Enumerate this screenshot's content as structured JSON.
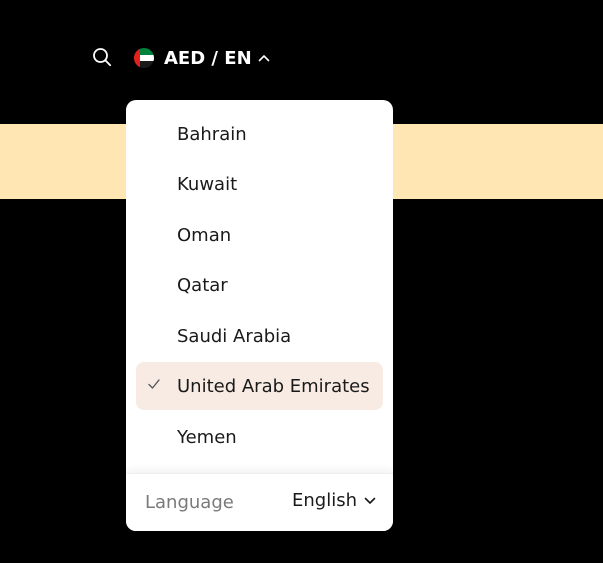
{
  "header": {
    "currency_language": "AED / EN"
  },
  "dropdown": {
    "countries": [
      {
        "label": "Bahrain",
        "selected": false
      },
      {
        "label": "Kuwait",
        "selected": false
      },
      {
        "label": "Oman",
        "selected": false
      },
      {
        "label": "Qatar",
        "selected": false
      },
      {
        "label": "Saudi Arabia",
        "selected": false
      },
      {
        "label": "United Arab Emirates",
        "selected": true
      },
      {
        "label": "Yemen",
        "selected": false
      }
    ],
    "language_label": "Language",
    "language_value": "English"
  },
  "colors": {
    "page_background": "#000000",
    "banner": "#ffe6b3",
    "selected_item": "#f7ebe4",
    "panel": "#ffffff"
  },
  "icons": {
    "search": "search-icon",
    "flag": "uae-flag-icon",
    "chevron_up": "chevron-up-icon",
    "check": "check-icon",
    "chevron_down": "chevron-down-icon"
  }
}
